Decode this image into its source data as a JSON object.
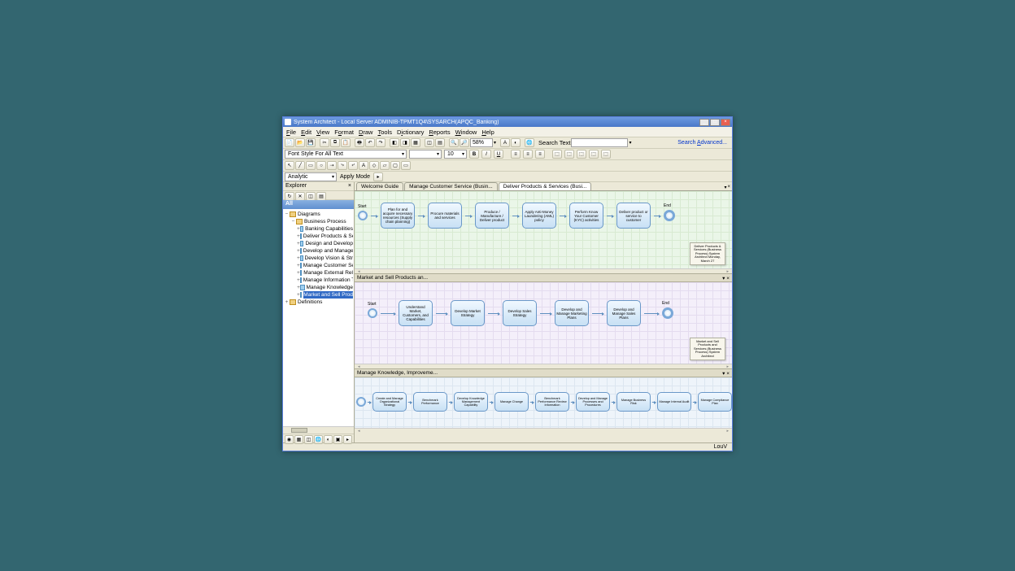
{
  "window": {
    "title": "System Architect - Local Server ADMINIB-TPMT1Q4\\SYSARCH(APQC_Banking)"
  },
  "menu": {
    "file": "File",
    "edit": "Edit",
    "view": "View",
    "format": "Format",
    "draw": "Draw",
    "tools": "Tools",
    "dictionary": "Dictionary",
    "reports": "Reports",
    "window": "Window",
    "help": "Help"
  },
  "toolbar": {
    "zoom": "58%",
    "search_label": "Search Text",
    "adv": "Search Advanced...",
    "fontcombo": "Font Style For All Text",
    "fontsize": "10",
    "analytic": "Analytic",
    "apply": "Apply Mode"
  },
  "explorer": {
    "title": "Explorer",
    "all": "All",
    "nodes": {
      "diagrams": "Diagrams",
      "bp": "Business Process",
      "items": [
        "Banking Capabilities",
        "Deliver Products & Se",
        "Design and Develop",
        "Develop and Manage",
        "Develop Vision & Str",
        "Manage Customer Se",
        "Manage External Rel",
        "Manage Information T",
        "Manage Knowledge",
        "Market and Sell Prod"
      ],
      "definitions": "Definitions"
    }
  },
  "tabs": {
    "t1": "Welcome Guide",
    "t2": "Manage Customer Service (Busin...",
    "t3": "Deliver Products & Services (Busi..."
  },
  "pane1": {
    "start": "Start",
    "end": "End",
    "boxes": [
      "Plan for and acquire necessary resources (Supply chain planning)",
      "Procure materials and services",
      "Produce / Manufacture / Deliver product",
      "Apply Anti-Money Laundering (AML) policy",
      "Perform Know Your Customer (KYC) activities",
      "Deliver product or service to customer"
    ],
    "note": "Deliver Products & Services (Business Process)\nSystem Architect\nMonday, March 27"
  },
  "pane2": {
    "title": "Market and Sell Products an...",
    "start": "Start",
    "end": "End",
    "boxes": [
      "Understand Market, Customers, and Capabilities",
      "Develop Market Strategy",
      "Develop Sales Strategy",
      "Develop and Manage Marketing Plans",
      "Develop and Manage Sales Plans"
    ],
    "note": "Market and Sell Products and Services (Business Process)\nSystem Architect"
  },
  "pane3": {
    "title": "Manage Knowledge, Improveme...",
    "boxes": [
      "Create and Manage Organizational Strategy",
      "Benchmark Performance",
      "Develop Knowledge Management Capability",
      "Manage Change",
      "Benchmark Performance Review Information",
      "Develop and Manage Processes and Procedures",
      "Manage Business Risk",
      "Manage Internal Audit",
      "Manage Compliance Plan"
    ]
  },
  "status": {
    "user": "LouV"
  }
}
